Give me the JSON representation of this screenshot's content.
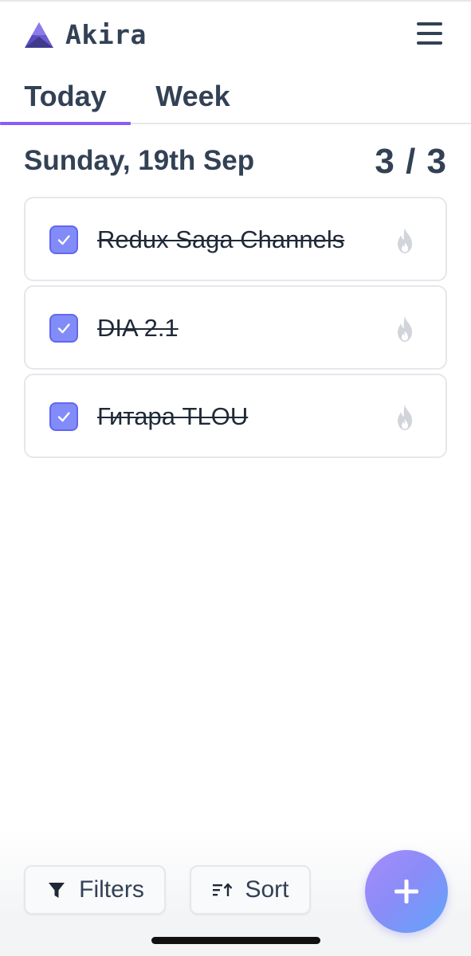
{
  "app": {
    "name": "Akira",
    "logo_icon": "akira-logo-icon",
    "menu_icon": "hamburger-menu-icon"
  },
  "tabs": [
    {
      "label": "Today",
      "active": true
    },
    {
      "label": "Week",
      "active": false
    }
  ],
  "day": {
    "title": "Sunday, 19th Sep",
    "progress": "3 / 3"
  },
  "tasks": [
    {
      "title": "Redux Saga Channels",
      "done": true,
      "priority_icon": "flame-icon"
    },
    {
      "title": "DIA 2.1",
      "done": true,
      "priority_icon": "flame-icon"
    },
    {
      "title": "Гитара TLOU",
      "done": true,
      "priority_icon": "flame-icon"
    }
  ],
  "toolbar": {
    "filters_label": "Filters",
    "filters_icon": "funnel-icon",
    "sort_label": "Sort",
    "sort_icon": "sort-icon",
    "add_icon": "plus-icon"
  },
  "colors": {
    "text": "#334155",
    "accent": "#8b5cf6",
    "checkbox": "#818cf8",
    "flame": "#d1d5db",
    "fab_gradient": [
      "#a78bfa",
      "#60a5fa"
    ]
  }
}
